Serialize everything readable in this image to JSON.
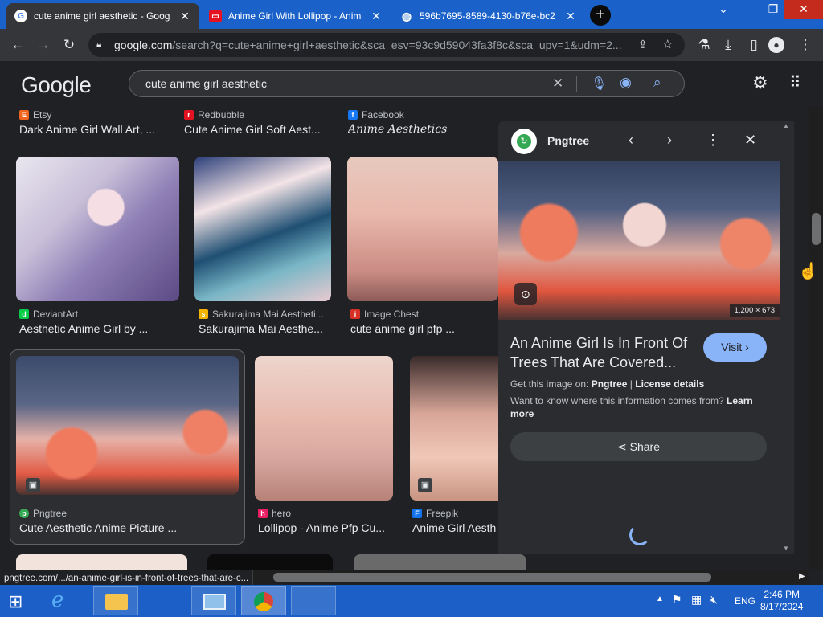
{
  "browser": {
    "tabs": [
      {
        "title": "cute anime girl aesthetic - Goog",
        "favicon": "google-icon"
      },
      {
        "title": "Anime Girl With Lollipop - Anim",
        "favicon": "redbubble-icon"
      },
      {
        "title": "596b7695-8589-4130-b76e-bc2",
        "favicon": "globe-icon"
      }
    ],
    "url_host": "google.com",
    "url_rest": "/search?q=cute+anime+girl+aesthetic&sca_esv=93c9d59043fa3f8c&sca_upv=1&udm=2..."
  },
  "google": {
    "logo": "Google",
    "query": "cute anime girl aesthetic"
  },
  "results": {
    "top_row": [
      {
        "source": "Etsy",
        "caption": "Dark Anime Girl Wall Art, ...",
        "color": "#f1641e"
      },
      {
        "source": "Redbubble",
        "caption": "Cute Anime Girl Soft Aest...",
        "color": "#e41321"
      },
      {
        "source": "Facebook",
        "caption": "Anime Aesthetics",
        "color": "#1877f2"
      }
    ],
    "row1": [
      {
        "source": "DeviantArt",
        "caption": "Aesthetic Anime Girl by ...",
        "color": "#05cc47"
      },
      {
        "source": "Sakurajima Mai Aestheti...",
        "caption": "Sakurajima Mai Aesthe...",
        "color": "#f5b400"
      },
      {
        "source": "Image Chest",
        "caption": "cute anime girl pfp ...",
        "color": "#d93025"
      }
    ],
    "row2": [
      {
        "source": "Pngtree",
        "caption": "Cute Aesthetic Anime Picture ...",
        "color": "#34a853"
      },
      {
        "source": "hero",
        "caption": "Lollipop - Anime Pfp Cu...",
        "color": "#e91e63"
      },
      {
        "source": "Freepik",
        "caption": "Anime Girl Aesth",
        "color": "#1273eb"
      }
    ]
  },
  "panel": {
    "source": "Pngtree",
    "dimensions": "1,200 × 673",
    "title_line1": "An Anime Girl Is In Front Of",
    "title_line2": "Trees That Are Covered...",
    "visit_label": "Visit",
    "get_image_prefix": "Get this image on:",
    "get_image_source": "Pngtree",
    "separator": "|",
    "license": "License details",
    "info_text": "Want to know where this information comes from?",
    "learn_more_1": "Learn",
    "learn_more_2": "more",
    "share_label": "Share"
  },
  "status_url": "pngtree.com/.../an-anime-girl-is-in-front-of-trees-that-are-c...",
  "taskbar": {
    "lang": "ENG",
    "time": "2:46 PM",
    "date": "8/17/2024"
  }
}
